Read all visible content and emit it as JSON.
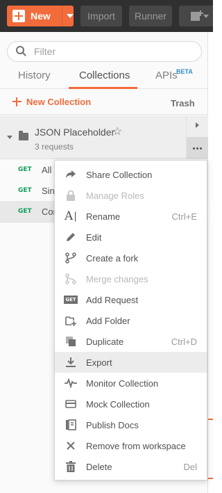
{
  "toolbar": {
    "new_label": "New",
    "import_label": "Import",
    "runner_label": "Runner"
  },
  "search": {
    "placeholder": "Filter"
  },
  "tabs": {
    "history": "History",
    "collections": "Collections",
    "apis": "APIs",
    "beta": "BETA"
  },
  "collections_bar": {
    "new_collection": "New Collection",
    "trash": "Trash"
  },
  "collection": {
    "name": "JSON Placeholder",
    "count": "3 requests"
  },
  "requests": [
    {
      "method": "GET",
      "name": "All posts"
    },
    {
      "method": "GET",
      "name": "Single post"
    },
    {
      "method": "GET",
      "name": "Comments"
    }
  ],
  "menu": {
    "items": [
      {
        "label": "Share Collection",
        "shortcut": "",
        "icon": "share-icon"
      },
      {
        "label": "Manage Roles",
        "shortcut": "",
        "icon": "lock-icon"
      },
      {
        "label": "Rename",
        "shortcut": "Ctrl+E",
        "icon": "rename-icon"
      },
      {
        "label": "Edit",
        "shortcut": "",
        "icon": "pencil-icon"
      },
      {
        "label": "Create a fork",
        "shortcut": "",
        "icon": "fork-icon"
      },
      {
        "label": "Merge changes",
        "shortcut": "",
        "icon": "merge-icon"
      },
      {
        "label": "Add Request",
        "shortcut": "",
        "icon": "get-request-icon"
      },
      {
        "label": "Add Folder",
        "shortcut": "",
        "icon": "add-folder-icon"
      },
      {
        "label": "Duplicate",
        "shortcut": "Ctrl+D",
        "icon": "duplicate-icon"
      },
      {
        "label": "Export",
        "shortcut": "",
        "icon": "download-icon"
      },
      {
        "label": "Monitor Collection",
        "shortcut": "",
        "icon": "pulse-icon"
      },
      {
        "label": "Mock Collection",
        "shortcut": "",
        "icon": "mock-server-icon"
      },
      {
        "label": "Publish Docs",
        "shortcut": "",
        "icon": "docs-icon"
      },
      {
        "label": "Remove from workspace",
        "shortcut": "",
        "icon": "close-icon"
      },
      {
        "label": "Delete",
        "shortcut": "Del",
        "icon": "trash-icon"
      }
    ]
  },
  "colors": {
    "accent": "#f26b3a",
    "toolbar_bg": "#303030",
    "get_method": "#0f9d58",
    "beta": "#2f8cce"
  }
}
